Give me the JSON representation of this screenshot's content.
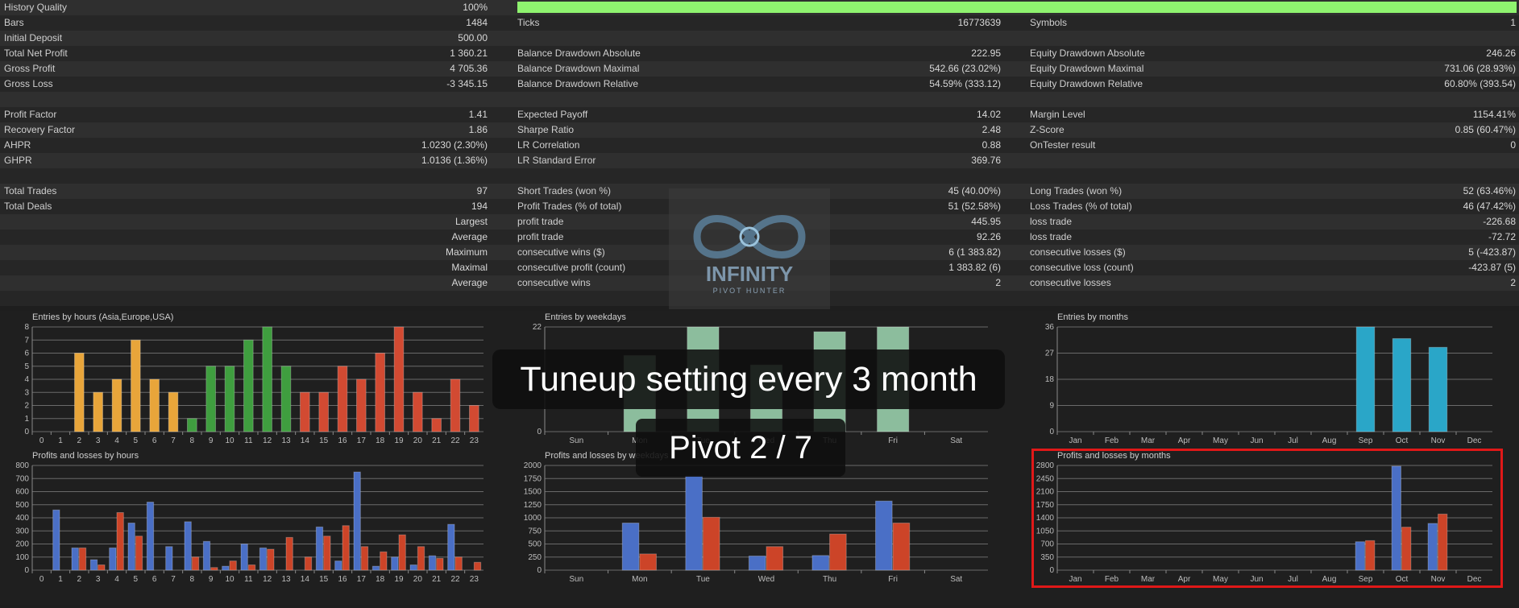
{
  "report": {
    "history_quality": {
      "label": "History Quality",
      "value": "100%",
      "fraction": 1.0
    },
    "rows": [
      {
        "c1": {
          "l": "Bars",
          "v": "1484"
        },
        "c2": {
          "l": "Ticks",
          "v": "16773639"
        },
        "c3": {
          "l": "Symbols",
          "v": "1"
        }
      },
      {
        "c1": {
          "l": "Initial Deposit",
          "v": "500.00"
        },
        "c2": null,
        "c3": null
      },
      {
        "c1": {
          "l": "Total Net Profit",
          "v": "1 360.21"
        },
        "c2": {
          "l": "Balance Drawdown Absolute",
          "v": "222.95"
        },
        "c3": {
          "l": "Equity Drawdown Absolute",
          "v": "246.26"
        }
      },
      {
        "c1": {
          "l": "Gross Profit",
          "v": "4 705.36"
        },
        "c2": {
          "l": "Balance Drawdown Maximal",
          "v": "542.66 (23.02%)"
        },
        "c3": {
          "l": "Equity Drawdown Maximal",
          "v": "731.06 (28.93%)"
        }
      },
      {
        "c1": {
          "l": "Gross Loss",
          "v": "-3 345.15"
        },
        "c2": {
          "l": "Balance Drawdown Relative",
          "v": "54.59% (333.12)"
        },
        "c3": {
          "l": "Equity Drawdown Relative",
          "v": "60.80% (393.54)"
        }
      },
      null,
      {
        "c1": {
          "l": "Profit Factor",
          "v": "1.41"
        },
        "c2": {
          "l": "Expected Payoff",
          "v": "14.02"
        },
        "c3": {
          "l": "Margin Level",
          "v": "1154.41%"
        }
      },
      {
        "c1": {
          "l": "Recovery Factor",
          "v": "1.86"
        },
        "c2": {
          "l": "Sharpe Ratio",
          "v": "2.48"
        },
        "c3": {
          "l": "Z-Score",
          "v": "0.85 (60.47%)"
        }
      },
      {
        "c1": {
          "l": "AHPR",
          "v": "1.0230 (2.30%)"
        },
        "c2": {
          "l": "LR Correlation",
          "v": "0.88"
        },
        "c3": {
          "l": "OnTester result",
          "v": "0"
        }
      },
      {
        "c1": {
          "l": "GHPR",
          "v": "1.0136 (1.36%)"
        },
        "c2": {
          "l": "LR Standard Error",
          "v": "369.76"
        },
        "c3": null
      },
      null,
      {
        "c1": {
          "l": "Total Trades",
          "v": "97"
        },
        "c2": {
          "l": "Short Trades (won %)",
          "v": "45 (40.00%)"
        },
        "c3": {
          "l": "Long Trades (won %)",
          "v": "52 (63.46%)"
        }
      },
      {
        "c1": {
          "l": "Total Deals",
          "v": "194"
        },
        "c2": {
          "l": "Profit Trades (% of total)",
          "v": "51 (52.58%)"
        },
        "c3": {
          "l": "Loss Trades (% of total)",
          "v": "46 (47.42%)"
        }
      },
      {
        "c1": {
          "l": "",
          "v": "Largest"
        },
        "c2": {
          "l": "profit trade",
          "v": "445.95"
        },
        "c3": {
          "l": "loss trade",
          "v": "-226.68"
        }
      },
      {
        "c1": {
          "l": "",
          "v": "Average"
        },
        "c2": {
          "l": "profit trade",
          "v": "92.26"
        },
        "c3": {
          "l": "loss trade",
          "v": "-72.72"
        }
      },
      {
        "c1": {
          "l": "",
          "v": "Maximum"
        },
        "c2": {
          "l": "consecutive wins ($)",
          "v": "6 (1 383.82)"
        },
        "c3": {
          "l": "consecutive losses ($)",
          "v": "5 (-423.87)"
        }
      },
      {
        "c1": {
          "l": "",
          "v": "Maximal"
        },
        "c2": {
          "l": "consecutive profit (count)",
          "v": "1 383.82 (6)"
        },
        "c3": {
          "l": "consecutive loss (count)",
          "v": "-423.87 (5)"
        }
      },
      {
        "c1": {
          "l": "",
          "v": "Average"
        },
        "c2": {
          "l": "consecutive wins",
          "v": "2"
        },
        "c3": {
          "l": "consecutive losses",
          "v": "2"
        }
      },
      null
    ]
  },
  "logo": {
    "line1": "INFINITY",
    "line2": "PIVOT HUNTER"
  },
  "overlay": {
    "banner": "Tuneup setting every 3 month",
    "sub_banner": "Pivot 2 / 7"
  },
  "colors": {
    "quality_bar": "#8ff36f",
    "asia": "#e8a53a",
    "europe": "#3f9e3f",
    "usa": "#d24a32",
    "weekday": "#9fd9b3",
    "months": "#2aa6c8",
    "profit": "#4a6fc6",
    "loss": "#cc4428",
    "highlight": "#e01818"
  },
  "chart_data": [
    {
      "id": "entries-hours",
      "type": "bar",
      "title": "Entries by hours (Asia,Europe,USA)",
      "categories": [
        "0",
        "1",
        "2",
        "3",
        "4",
        "5",
        "6",
        "7",
        "8",
        "9",
        "10",
        "11",
        "12",
        "13",
        "14",
        "15",
        "16",
        "17",
        "18",
        "19",
        "20",
        "21",
        "22",
        "23"
      ],
      "values": [
        0,
        0,
        6,
        3,
        4,
        7,
        4,
        3,
        1,
        5,
        5,
        7,
        8,
        5,
        3,
        3,
        5,
        4,
        6,
        8,
        3,
        1,
        4,
        2
      ],
      "ylim": [
        0,
        8
      ],
      "yticks": [
        0,
        1,
        2,
        3,
        4,
        5,
        6,
        7,
        8
      ]
    },
    {
      "id": "entries-weekdays",
      "type": "bar",
      "title": "Entries by weekdays",
      "categories": [
        "Sun",
        "Mon",
        "Tue",
        "Wed",
        "Thu",
        "Fri",
        "Sat"
      ],
      "values": [
        0,
        16,
        22,
        14,
        21,
        22,
        0
      ],
      "ylim": [
        0,
        22
      ],
      "yticks": [
        0,
        22
      ]
    },
    {
      "id": "entries-months",
      "type": "bar",
      "title": "Entries by months",
      "categories": [
        "Jan",
        "Feb",
        "Mar",
        "Apr",
        "May",
        "Jun",
        "Jul",
        "Aug",
        "Sep",
        "Oct",
        "Nov",
        "Dec"
      ],
      "values": [
        0,
        0,
        0,
        0,
        0,
        0,
        0,
        0,
        36,
        32,
        29,
        0
      ],
      "ylim": [
        0,
        36
      ],
      "yticks": [
        0,
        9,
        18,
        27,
        36
      ]
    },
    {
      "id": "pl-hours",
      "type": "bar",
      "title": "Profits and losses by hours",
      "categories": [
        "0",
        "1",
        "2",
        "3",
        "4",
        "5",
        "6",
        "7",
        "8",
        "9",
        "10",
        "11",
        "12",
        "13",
        "14",
        "15",
        "16",
        "17",
        "18",
        "19",
        "20",
        "21",
        "22",
        "23"
      ],
      "series": [
        {
          "name": "profit",
          "values": [
            0,
            460,
            170,
            80,
            170,
            360,
            520,
            180,
            370,
            220,
            30,
            200,
            170,
            0,
            0,
            330,
            70,
            750,
            30,
            100,
            40,
            110,
            350,
            0
          ]
        },
        {
          "name": "loss",
          "values": [
            0,
            0,
            170,
            40,
            440,
            260,
            0,
            0,
            100,
            20,
            70,
            40,
            160,
            250,
            100,
            260,
            340,
            180,
            140,
            270,
            180,
            90,
            100,
            60
          ]
        }
      ],
      "ylim": [
        0,
        800
      ],
      "yticks": [
        0,
        100,
        200,
        300,
        400,
        500,
        600,
        700,
        800
      ]
    },
    {
      "id": "pl-weekdays",
      "type": "bar",
      "title": "Profits and losses by weekdays",
      "categories": [
        "Sun",
        "Mon",
        "Tue",
        "Wed",
        "Thu",
        "Fri",
        "Sat"
      ],
      "series": [
        {
          "name": "profit",
          "values": [
            0,
            900,
            1800,
            270,
            280,
            1320,
            0
          ]
        },
        {
          "name": "loss",
          "values": [
            0,
            310,
            1010,
            450,
            690,
            900,
            0
          ]
        }
      ],
      "ylim": [
        0,
        2000
      ],
      "yticks": [
        0,
        250,
        500,
        750,
        1000,
        1250,
        1500,
        1750,
        2000
      ]
    },
    {
      "id": "pl-months",
      "type": "bar",
      "title": "Profits and losses by months",
      "categories": [
        "Jan",
        "Feb",
        "Mar",
        "Apr",
        "May",
        "Jun",
        "Jul",
        "Aug",
        "Sep",
        "Oct",
        "Nov",
        "Dec"
      ],
      "series": [
        {
          "name": "profit",
          "values": [
            0,
            0,
            0,
            0,
            0,
            0,
            0,
            0,
            760,
            2780,
            1250,
            0
          ]
        },
        {
          "name": "loss",
          "values": [
            0,
            0,
            0,
            0,
            0,
            0,
            0,
            0,
            790,
            1150,
            1500,
            0
          ]
        }
      ],
      "ylim": [
        0,
        2800
      ],
      "yticks": [
        0,
        350,
        700,
        1050,
        1400,
        1750,
        2100,
        2450,
        2800
      ]
    }
  ]
}
